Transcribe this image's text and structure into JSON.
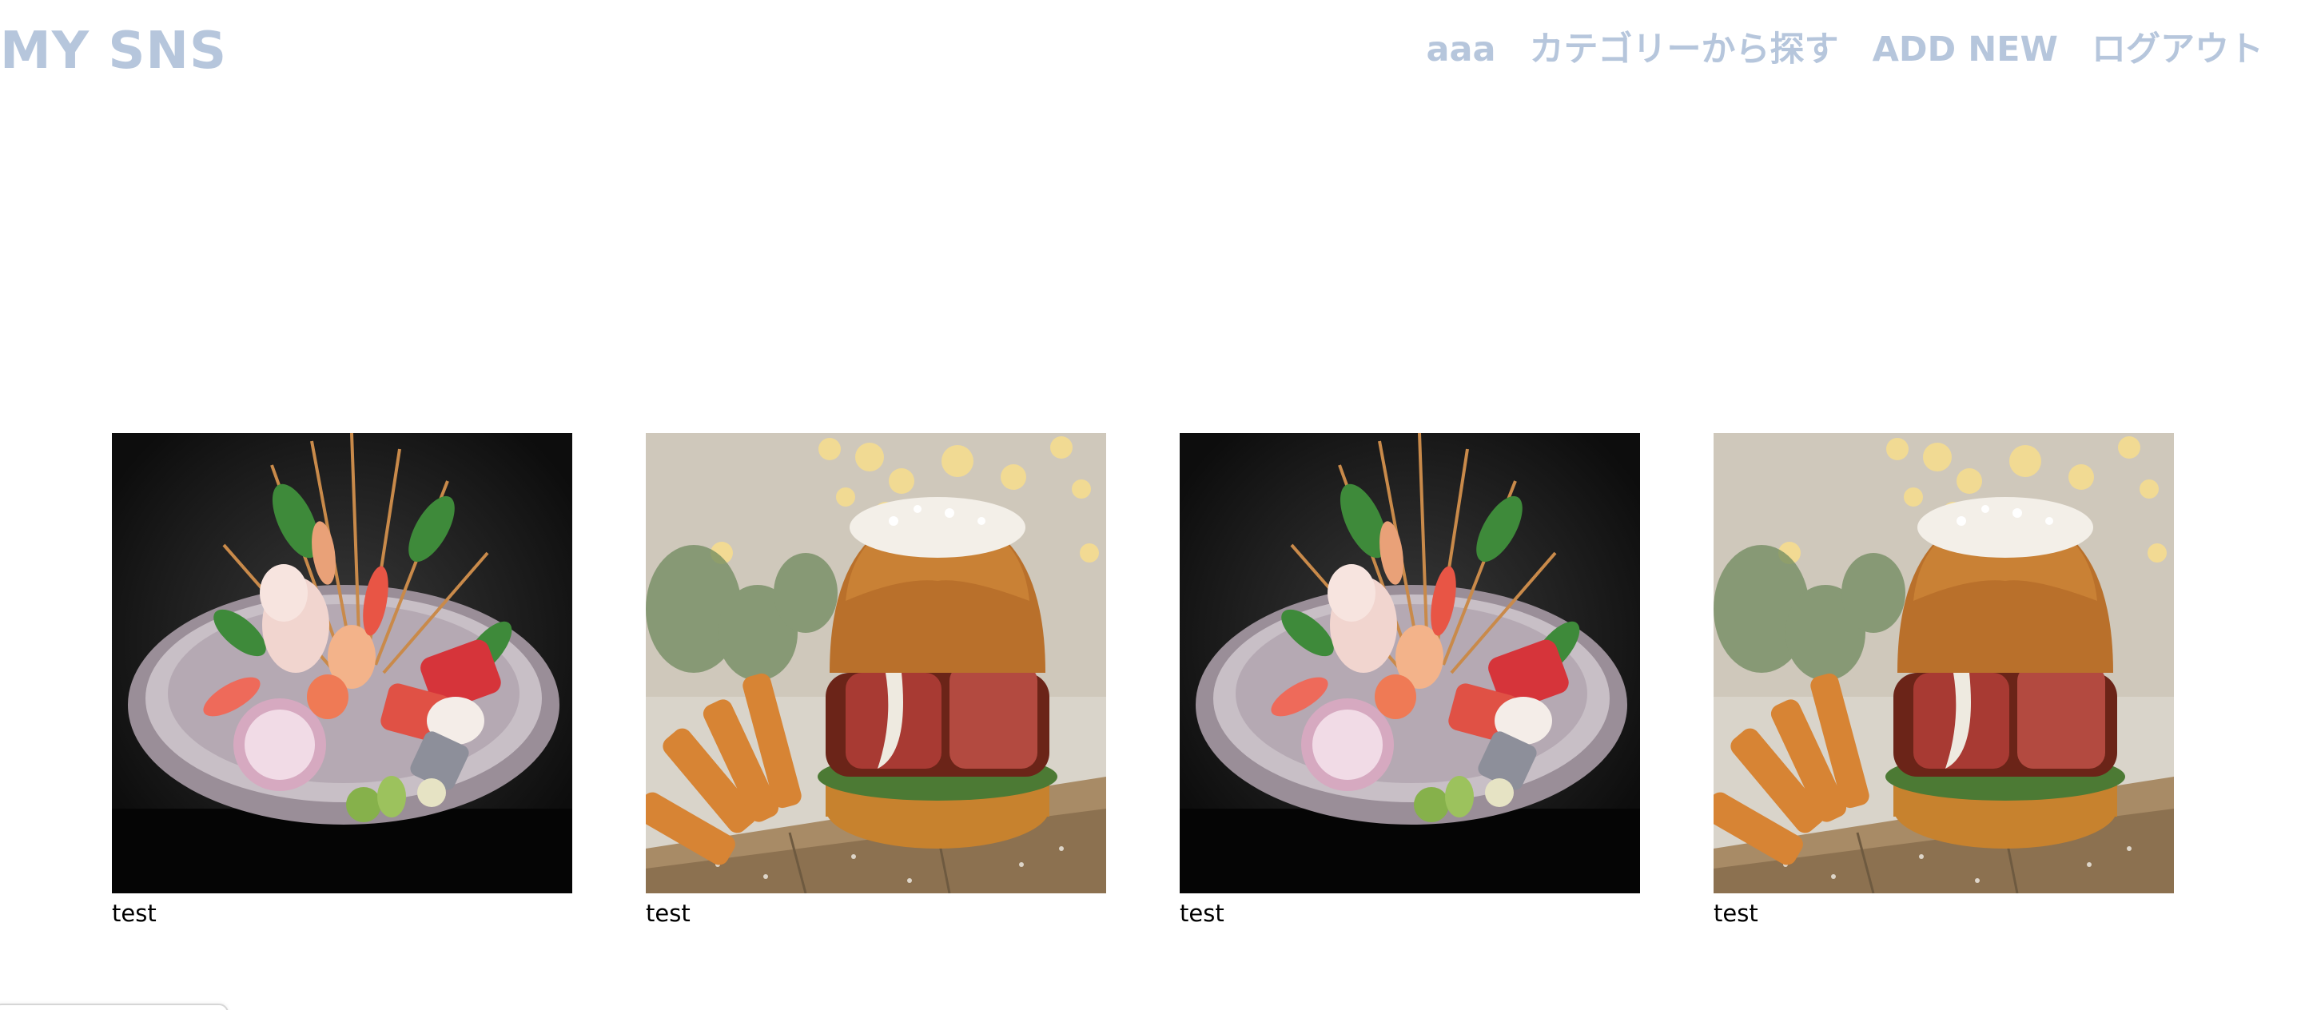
{
  "header": {
    "logo": "MY SNS",
    "nav": [
      {
        "label": "aaa"
      },
      {
        "label": "カテゴリーから探す"
      },
      {
        "label": "ADD NEW"
      },
      {
        "label": "ログアウト"
      }
    ]
  },
  "posts": [
    {
      "title": "test",
      "image": "sashimi-platter-photo"
    },
    {
      "title": "test",
      "image": "hamburger-photo"
    },
    {
      "title": "test",
      "image": "sashimi-platter-photo"
    },
    {
      "title": "test",
      "image": "hamburger-photo"
    }
  ],
  "colors": {
    "header_text": "#b6c6dc",
    "body_text": "#000000",
    "background": "#ffffff"
  }
}
